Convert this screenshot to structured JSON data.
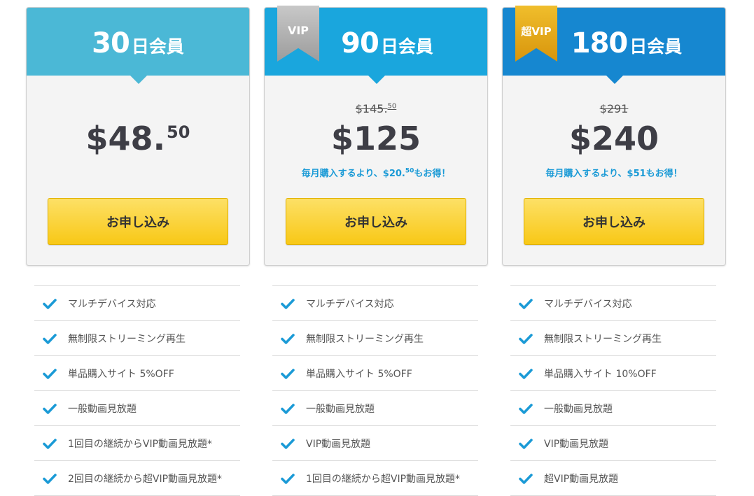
{
  "colors": {
    "plan1_header": "#4bb8d6",
    "plan2_header": "#1aa6dd",
    "plan3_header": "#1687d0",
    "check": "#1a9ad6",
    "button": "#f8c816",
    "ribbon_silver": "#b0b0b0",
    "ribbon_gold": "#e4a81a"
  },
  "plans": [
    {
      "title_num": "30",
      "title_unit": "日会員",
      "price_main": "$48.",
      "price_sup": "50",
      "button_label": "お申し込み",
      "features": [
        "マルチデバイス対応",
        "無制限ストリーミング再生",
        "単品購入サイト 5%OFF",
        "一般動画見放題",
        "1回目の継続からVIP動画見放題*",
        "2回目の継続から超VIP動画見放題*"
      ]
    },
    {
      "ribbon": "VIP",
      "title_num": "90",
      "title_unit": "日会員",
      "old_price_main": "$145.",
      "old_price_sup": "50",
      "price_main": "$125",
      "save_before": "毎月購入するより、$20.",
      "save_sup": "50",
      "save_after": "もお得！",
      "button_label": "お申し込み",
      "features": [
        "マルチデバイス対応",
        "無制限ストリーミング再生",
        "単品購入サイト 5%OFF",
        "一般動画見放題",
        "VIP動画見放題",
        "1回目の継続から超VIP動画見放題*"
      ]
    },
    {
      "ribbon": "超VIP",
      "title_num": "180",
      "title_unit": "日会員",
      "old_price_main": "$291",
      "price_main": "$240",
      "save_text": "毎月購入するより、$51もお得！",
      "button_label": "お申し込み",
      "features": [
        "マルチデバイス対応",
        "無制限ストリーミング再生",
        "単品購入サイト 10%OFF",
        "一般動画見放題",
        "VIP動画見放題",
        "超VIP動画見放題"
      ]
    }
  ]
}
